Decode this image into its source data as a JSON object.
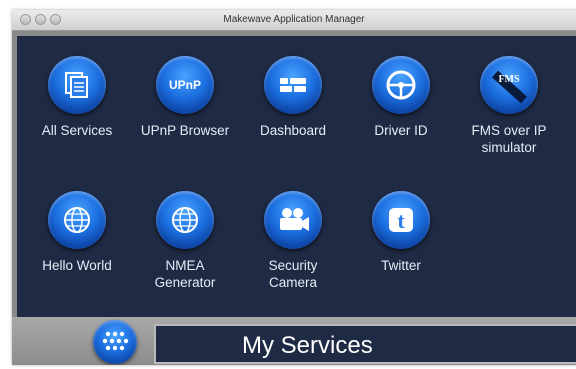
{
  "window": {
    "title": "Makewave Application Manager"
  },
  "tiles": [
    {
      "label": "All Services",
      "icon": "all-services-icon"
    },
    {
      "label": "UPnP Browser",
      "icon": "upnp-icon",
      "glyph": "UPnP"
    },
    {
      "label": "Dashboard",
      "icon": "dashboard-icon"
    },
    {
      "label": "Driver ID",
      "icon": "steering-wheel-icon"
    },
    {
      "label": "FMS over IP simulator",
      "icon": "fms-icon",
      "glyph": "FMS"
    },
    {
      "label": "Hello World",
      "icon": "globe-icon"
    },
    {
      "label": "NMEA Generator",
      "icon": "globe-icon"
    },
    {
      "label": "Security Camera",
      "icon": "video-camera-icon"
    },
    {
      "label": "Twitter",
      "icon": "twitter-icon",
      "glyph": "t"
    }
  ],
  "footer": {
    "title": "My Services",
    "menu_icon": "grid-menu-icon"
  },
  "colors": {
    "accent": "#1c6fe0",
    "panel": "#1f2a44",
    "label": "#e6ecf7"
  }
}
